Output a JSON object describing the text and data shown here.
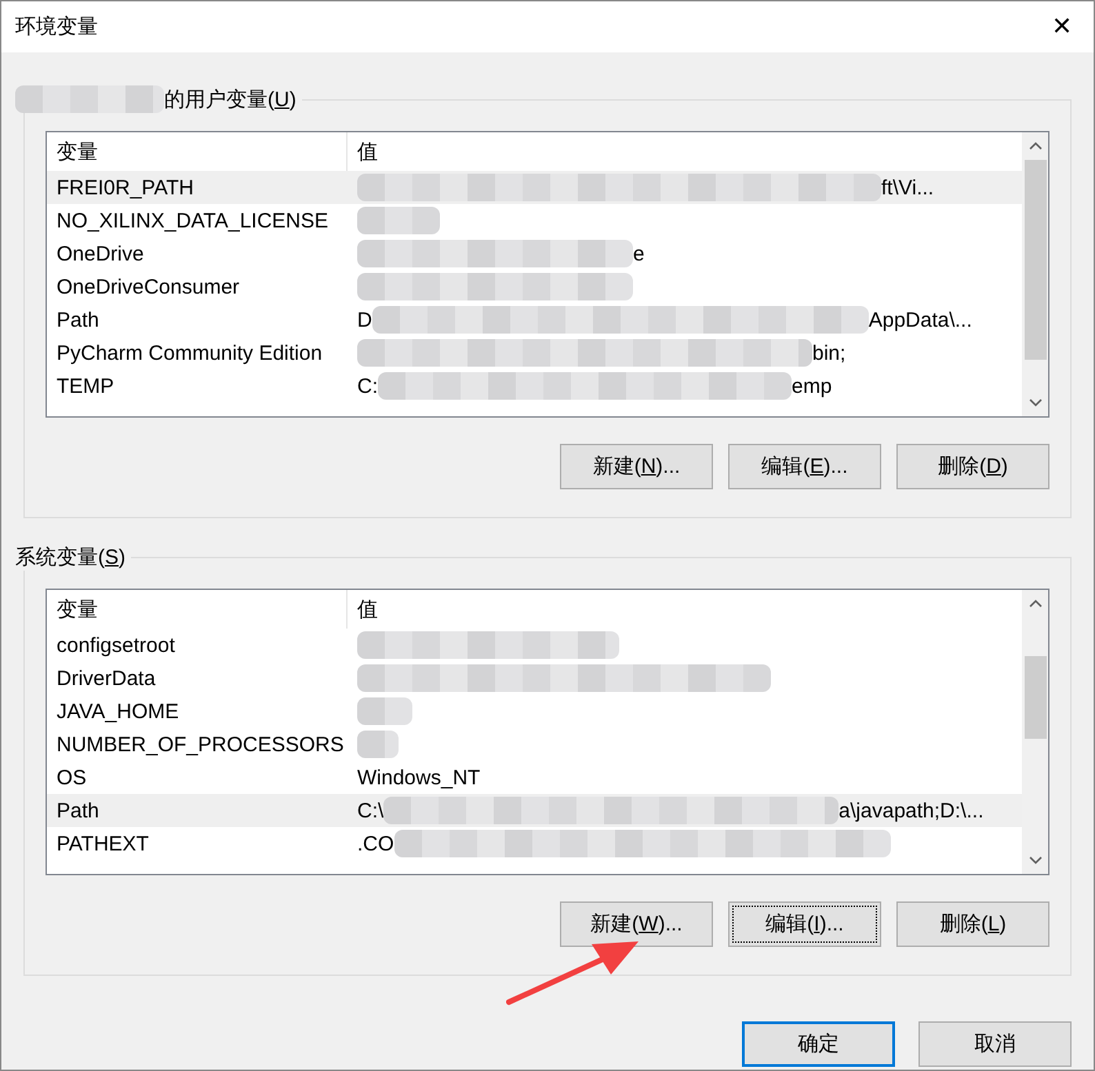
{
  "window": {
    "title": "环境变量",
    "close": "✕"
  },
  "sections": [
    {
      "title": {
        "before": "的用户变量(",
        "access_key": "U",
        "after": ")",
        "redacted_prefix": true
      },
      "columns": [
        "变量",
        "值"
      ],
      "rows": [
        {
          "name": "FREI0R_PATH",
          "value_end": "ft\\Vi...",
          "selected": true
        },
        {
          "name": "NO_XILINX_DATA_LICENSE",
          "selected": false
        },
        {
          "name": "OneDrive",
          "value_end": "e",
          "selected": false
        },
        {
          "name": "OneDriveConsumer",
          "selected": false
        },
        {
          "name": "Path",
          "value_start": "D",
          "value_end": "AppData\\...",
          "selected": false
        },
        {
          "name": "PyCharm Community Edition",
          "value_end": "bin;",
          "selected": false
        },
        {
          "name": "TEMP",
          "value_start": "C:",
          "value_end": "emp",
          "selected": false
        }
      ],
      "buttons": [
        {
          "before": "新建(",
          "access_key": "N",
          "after": ")...",
          "focused": false
        },
        {
          "before": "编辑(",
          "access_key": "E",
          "after": ")...",
          "focused": false
        },
        {
          "before": "删除(",
          "access_key": "D",
          "after": ")",
          "focused": false
        }
      ]
    },
    {
      "title": {
        "before": "系统变量(",
        "access_key": "S",
        "after": ")"
      },
      "columns": [
        "变量",
        "值"
      ],
      "rows": [
        {
          "name": "configsetroot",
          "selected": false
        },
        {
          "name": "DriverData",
          "selected": false
        },
        {
          "name": "JAVA_HOME",
          "selected": false
        },
        {
          "name": "NUMBER_OF_PROCESSORS",
          "selected": false
        },
        {
          "name": "OS",
          "value_start": "Windows_NT",
          "selected": false
        },
        {
          "name": "Path",
          "value_start": "C:\\",
          "value_end": "a\\javapath;D:\\...",
          "selected": true
        },
        {
          "name": "PATHEXT",
          "value_start": ".CO",
          "selected": false
        }
      ],
      "buttons": [
        {
          "before": "新建(",
          "access_key": "W",
          "after": ")...",
          "focused": false
        },
        {
          "before": "编辑(",
          "access_key": "I",
          "after": ")...",
          "focused": true
        },
        {
          "before": "删除(",
          "access_key": "L",
          "after": ")",
          "focused": false
        }
      ]
    }
  ],
  "footer_buttons": [
    {
      "label": "确定",
      "default": true
    },
    {
      "label": "取消",
      "default": false
    }
  ],
  "annotation": {
    "kind": "arrow"
  }
}
